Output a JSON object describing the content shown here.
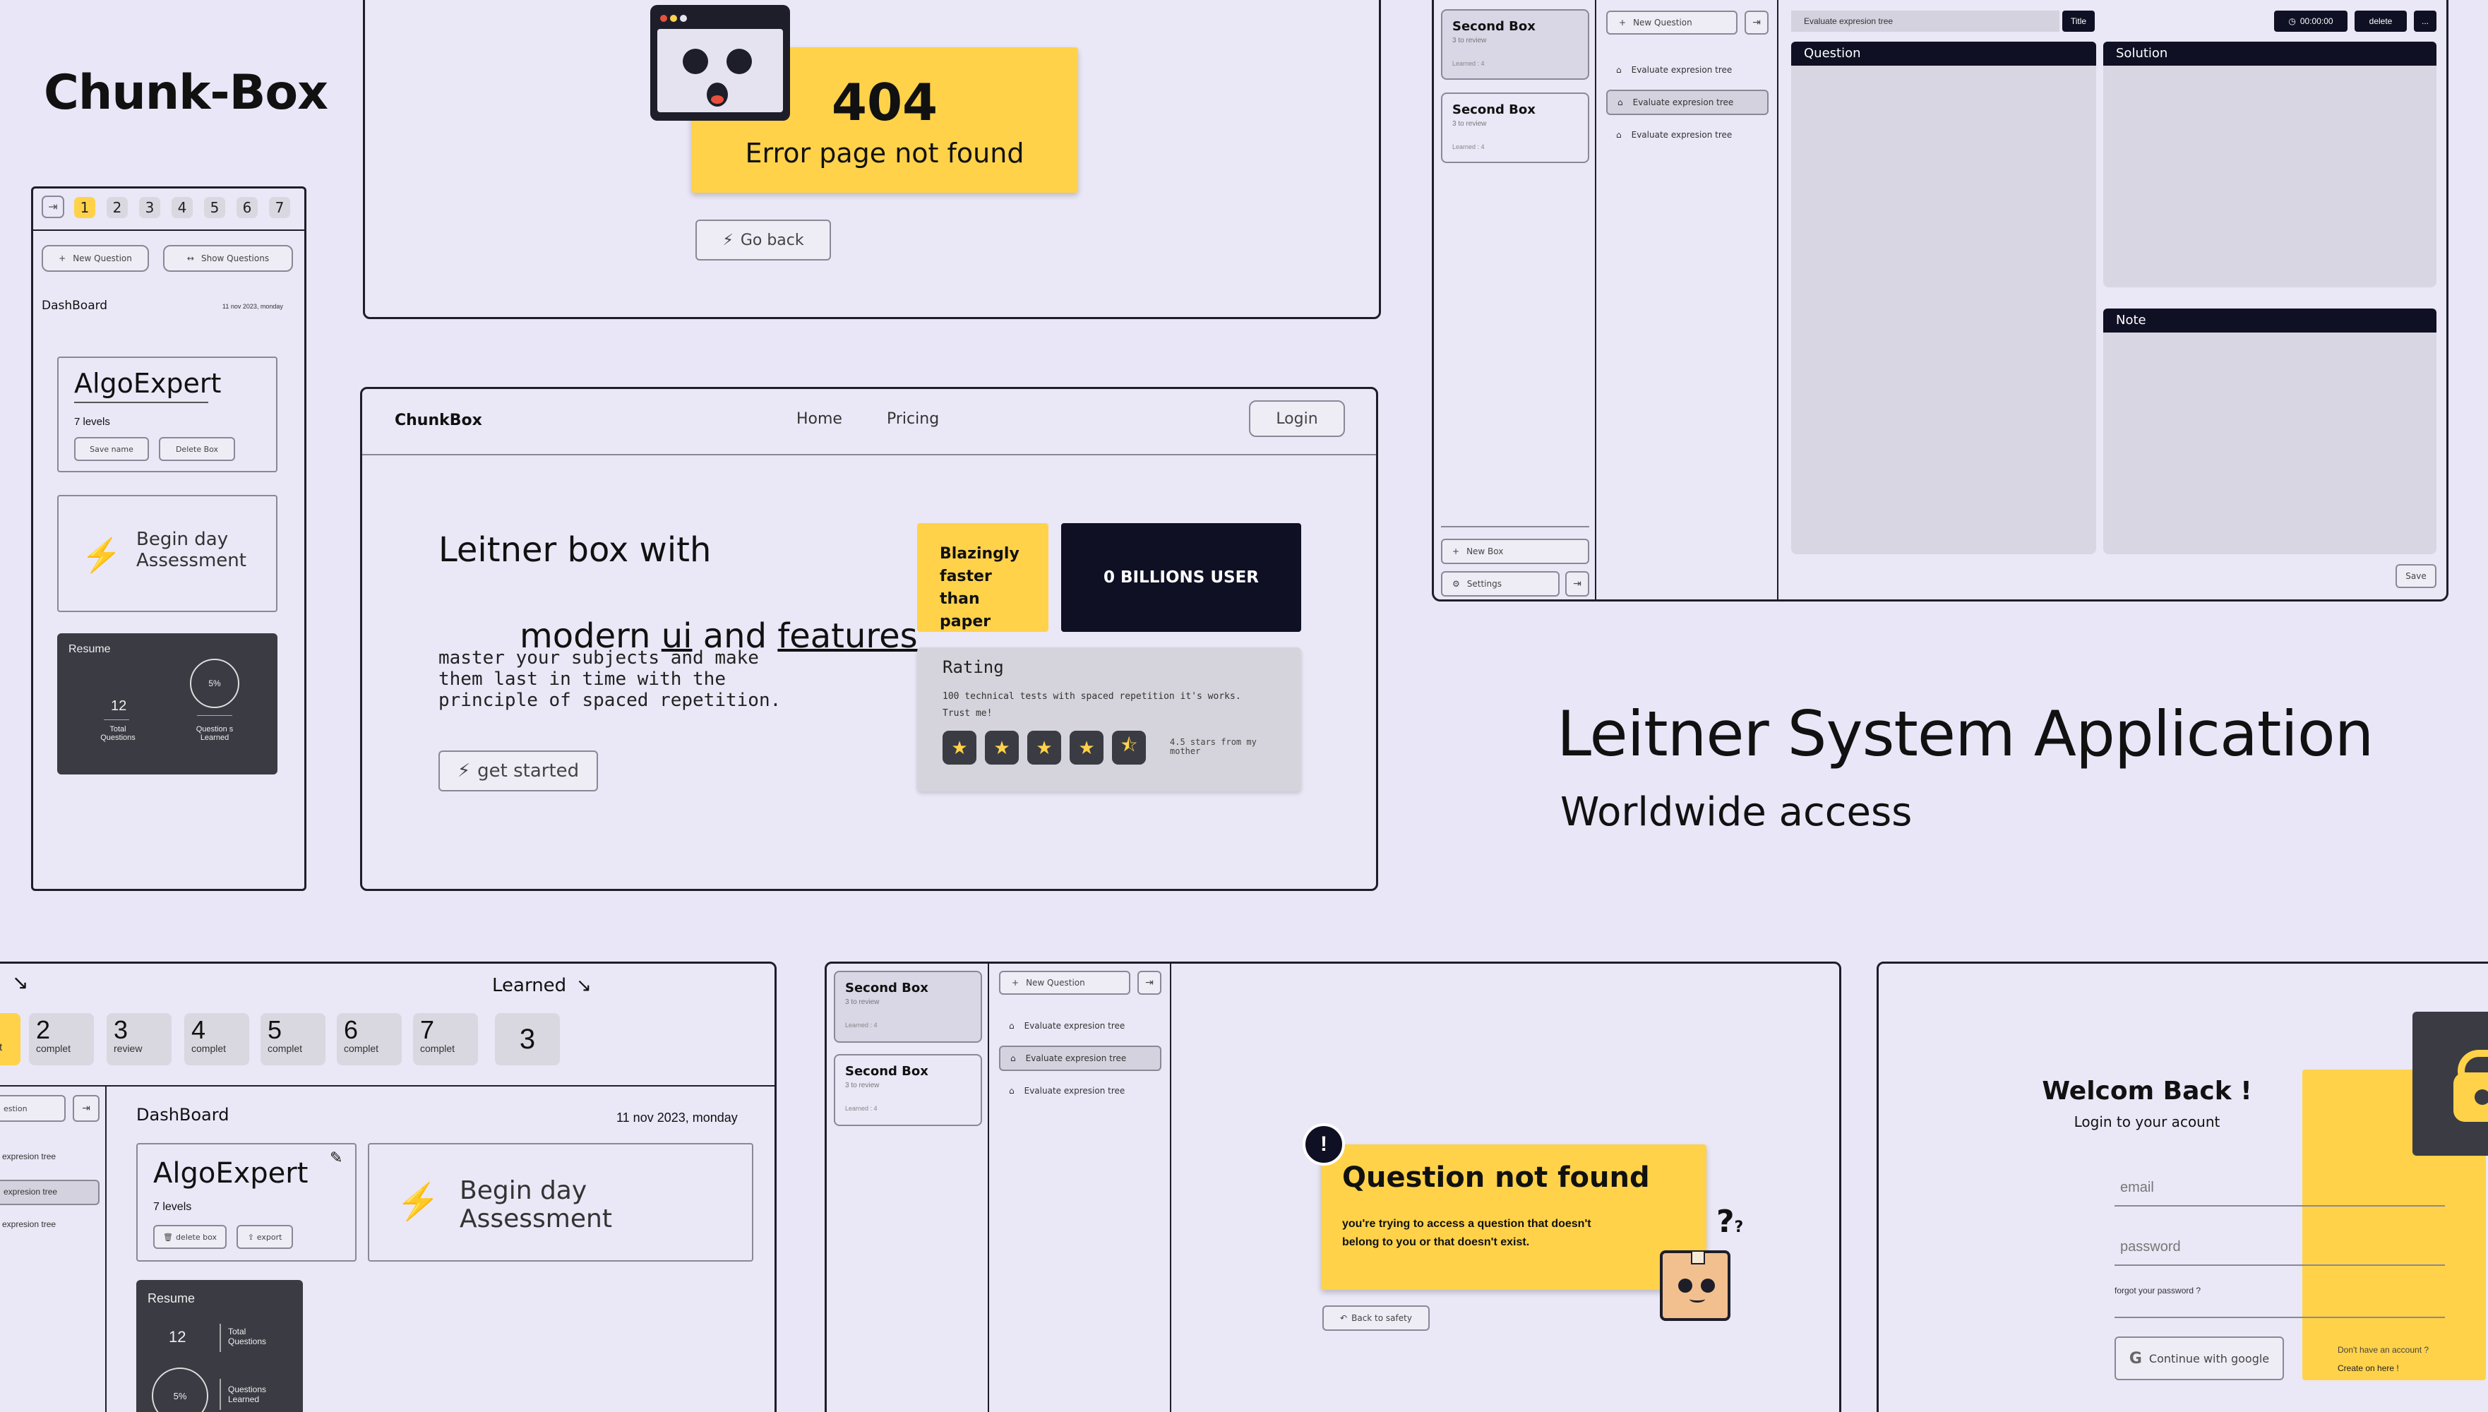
{
  "brand": {
    "title": "Chunk-Box"
  },
  "headline": {
    "title": "Leitner System Application",
    "subtitle": "Worldwide access"
  },
  "mobile": {
    "levels": [
      "1",
      "2",
      "3",
      "4",
      "5",
      "6",
      "7"
    ],
    "new_question": "New Question",
    "show_questions": "Show Questions",
    "dashboard": "DashBoard",
    "date": "11 nov 2023, monday",
    "box_name": "AlgoExpert",
    "box_levels": "7 levels",
    "save_name": "Save name",
    "delete_box": "Delete Box",
    "assessment": "Begin day Assessment",
    "resume": "Resume",
    "total_count": "12",
    "total_label": "Total Questions",
    "percent": "5%",
    "learned_label": "Question s Learned"
  },
  "error404": {
    "code": "404",
    "message": "Error page not found",
    "back": "Go back"
  },
  "landing": {
    "logo": "ChunkBox",
    "nav": [
      "Home",
      "Pricing"
    ],
    "login": "Login",
    "hero_line1": "Leitner box with",
    "hero_line2a": "modern ",
    "hero_ui": "ui",
    "hero_and": " and ",
    "hero_features": "features",
    "description": "master your subjects and make them last in time with the principle of spaced repetition.",
    "cta": "get started",
    "faster": "Blazingly faster than paper",
    "users": "0 BILLIONS USER",
    "rating_title": "Rating",
    "rating_text": "100 technical tests with spaced repetition it's works. Trust me!",
    "rating_value": 4.5,
    "rating_caption": "4.5 stars from my mother"
  },
  "editor": {
    "boxes": [
      {
        "name": "Second Box",
        "review": "3 to review",
        "learned": "Learned : 4"
      },
      {
        "name": "Second Box",
        "review": "3 to review",
        "learned": "Learned : 4"
      }
    ],
    "new_question": "New Question",
    "questions": [
      "Evaluate expresion tree",
      "Evaluate expresion tree",
      "Evaluate expresion tree"
    ],
    "title_value": "Evaluate expresion tree",
    "title_tag": "Title",
    "timer": "00:00:00",
    "delete": "delete",
    "more": "...",
    "question": "Question",
    "solution": "Solution",
    "note": "Note",
    "save": "Save",
    "new_box": "New Box",
    "settings": "Settings"
  },
  "desktop_dash": {
    "learned": "Learned",
    "levels": [
      {
        "n": "2",
        "label": "complet"
      },
      {
        "n": "3",
        "label": "review"
      },
      {
        "n": "4",
        "label": "complet"
      },
      {
        "n": "5",
        "label": "complet"
      },
      {
        "n": "6",
        "label": "complet"
      },
      {
        "n": "7",
        "label": "complet"
      }
    ],
    "extra": "3",
    "partial_label": "t",
    "partial_input": "estion",
    "side_items": [
      "expresion tree",
      "expresion tree",
      "expresion tree"
    ],
    "dashboard": "DashBoard",
    "date": "11 nov 2023, monday",
    "box_name": "AlgoExpert",
    "box_levels": "7 levels",
    "delete_box": "delete box",
    "export": "export",
    "assessment": "Begin day Assessment",
    "resume": "Resume",
    "total_count": "12",
    "total_label": "Total Questions",
    "percent": "5%",
    "learned_label": "Questions Learned"
  },
  "not_found": {
    "title": "Question not found",
    "message": "you're trying to access a question that doesn't belong to you or that doesn't exist.",
    "back": "Back to safety"
  },
  "login": {
    "title": "Welcom Back !",
    "subtitle": "Login to your acount",
    "email": "email",
    "password": "password",
    "forgot": "forgot your password ?",
    "google": "Continue with google",
    "no_account": "Don't have an account ?",
    "create": "Create on here !"
  },
  "colors": {
    "accent": "#ffd24a",
    "dark": "#3a3b43",
    "navy": "#0f1024",
    "bg": "#e9e6f7"
  }
}
